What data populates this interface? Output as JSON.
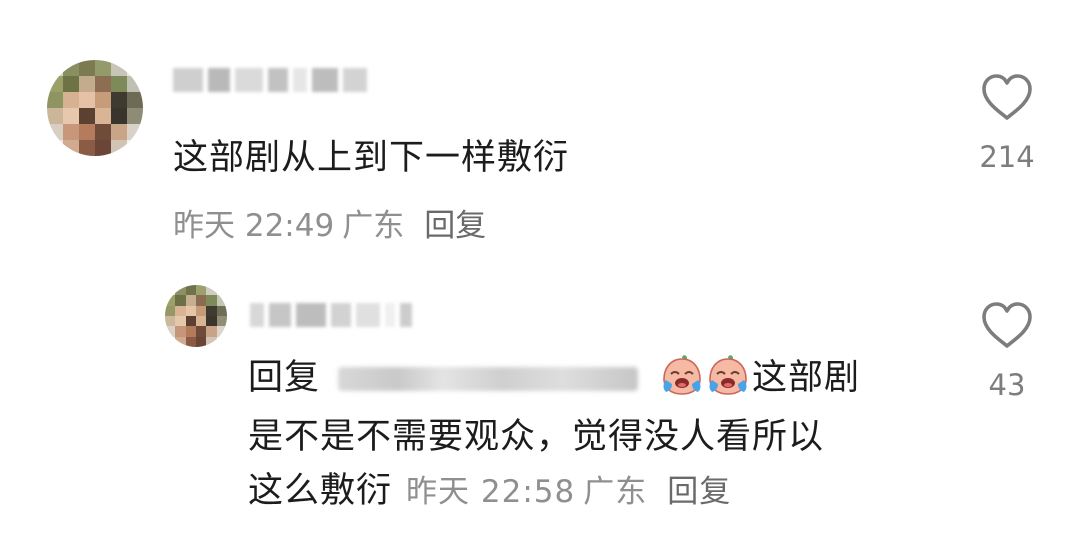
{
  "comments": [
    {
      "text": "这部剧从上到下一样敷衍",
      "time": "昨天 22:49",
      "location": "广东",
      "reply_label": "回复",
      "like_count": "214",
      "like_icon": "heart-outline-icon"
    },
    {
      "reply_prefix": "回复",
      "emoji_name": "crying-face-emoji",
      "text_line1": "这部剧",
      "text_line2": "是不是不需要观众，觉得没人看所以",
      "text_line3": "这么敷衍",
      "time": "昨天 22:58",
      "location": "广东",
      "reply_label": "回复",
      "like_count": "43",
      "like_icon": "heart-outline-icon"
    }
  ],
  "colors": {
    "text": "#1c1c1c",
    "meta": "#8f8f8f",
    "icon": "#7d7d7d"
  }
}
